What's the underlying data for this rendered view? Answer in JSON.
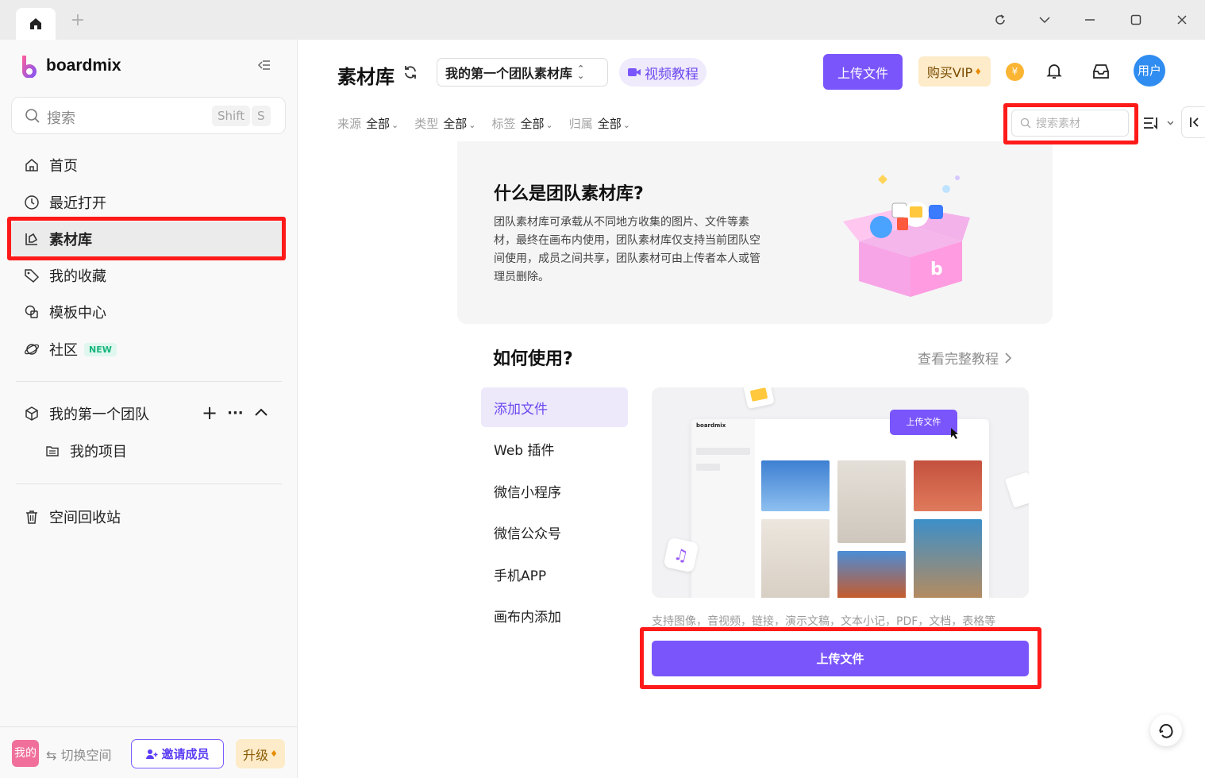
{
  "titlebar": {
    "add_tab": "+"
  },
  "sidebar": {
    "logo_text": "boardmix",
    "search": {
      "placeholder": "搜索",
      "shortcut_1": "Shift",
      "shortcut_2": "S"
    },
    "nav": [
      {
        "label": "首页",
        "icon": "home-icon"
      },
      {
        "label": "最近打开",
        "icon": "clock-icon"
      },
      {
        "label": "素材库",
        "icon": "library-icon",
        "active": true
      },
      {
        "label": "我的收藏",
        "icon": "tag-icon"
      },
      {
        "label": "模板中心",
        "icon": "template-icon"
      },
      {
        "label": "社区",
        "icon": "planet-icon",
        "badge": "NEW"
      }
    ],
    "team": {
      "name": "我的第一个团队",
      "add": "+",
      "more": "···"
    },
    "project": {
      "label": "我的项目"
    },
    "trash": {
      "label": "空间回收站"
    },
    "bottom": {
      "avatar": "我的",
      "switch_space": "切换空间",
      "invite": "邀请成员",
      "upgrade": "升级"
    }
  },
  "header": {
    "title": "素材库",
    "library_select": "我的第一个团队素材库",
    "video_tutorial": "视频教程",
    "upload": "上传文件",
    "buy_vip": "购买VIP",
    "coin": "¥",
    "user": "用户"
  },
  "filters": [
    {
      "key": "来源",
      "value": "全部"
    },
    {
      "key": "类型",
      "value": "全部"
    },
    {
      "key": "标签",
      "value": "全部"
    },
    {
      "key": "归属",
      "value": "全部"
    }
  ],
  "asset_search": {
    "placeholder": "搜索素材"
  },
  "intro": {
    "title": "什么是团队素材库?",
    "desc": "团队素材库可承载从不同地方收集的图片、文件等素材，最终在画布内使用，团队素材库仅支持当前团队空间使用，成员之间共享，团队素材可由上传者本人或管理员删除。"
  },
  "howto": {
    "title": "如何使用?",
    "full_tutorial": "查看完整教程",
    "items": [
      "添加文件",
      "Web 插件",
      "微信小程序",
      "微信公众号",
      "手机APP",
      "画布内添加"
    ],
    "preview": {
      "logo": "boardmix",
      "upload_label": "上传文件"
    },
    "supports": "支持图像，音视频，链接，演示文稿，文本小记，PDF，文档，表格等",
    "upload_button": "上传文件"
  },
  "colors": {
    "accent": "#7a55fb",
    "highlight": "#ff1a1a"
  }
}
